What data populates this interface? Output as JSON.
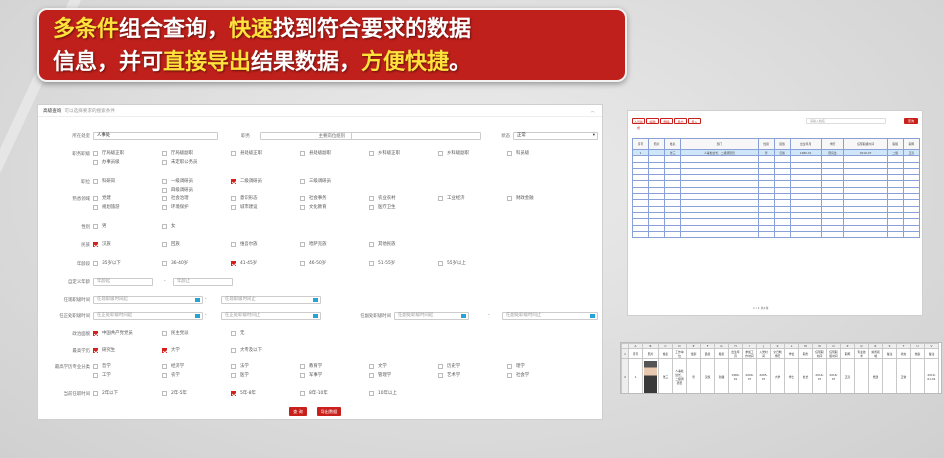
{
  "banner": {
    "line1_pre": "",
    "line1_hl1": "多条件",
    "line1_mid": "组合查询，",
    "line1_hl2": "快速",
    "line1_post": "找到符合要求的数据",
    "line2_pre": "信息，并可",
    "line2_hl1": "直接导出",
    "line2_mid": "结果数据，",
    "line2_hl2": "方便快捷",
    "line2_post": "。"
  },
  "form": {
    "title": "高级查询",
    "subtitle": "可以选择要求的搜索条件",
    "unit_label": "所在处室",
    "unit_value": "人事处",
    "post_label": "职务",
    "post_value": "",
    "mgr_label": "主要岗位组别",
    "mgr_value": "",
    "status_label": "状态",
    "status_value": "正常",
    "rank_label": "职务职级",
    "rank_opts": [
      "厅局级正职",
      "厅局级副职",
      "县处级正职",
      "县处级副职",
      "乡科级正职",
      "乡科级副职",
      "科员级",
      "办事员级",
      "未定职公务员"
    ],
    "level_label": "职位",
    "level_opts": [
      "一级调研员",
      "二级调研员",
      "三级调研员",
      "四级调研员"
    ],
    "level_first": "科研岗",
    "field_label": "熟悉领域",
    "field_opts": [
      "党建",
      "社会治理",
      "意识形态",
      "社会事务",
      "农业农村",
      "工业经济",
      "财政金融",
      "规划旅游",
      "环境保护",
      "城市建设",
      "文化教育",
      "医疗卫生"
    ],
    "sex_label": "性别",
    "sex_opts": [
      "男",
      "女"
    ],
    "nation_label": "民族",
    "nation_opts": [
      "汉族",
      "回族",
      "维吾尔族",
      "哈萨克族",
      "其他民族"
    ],
    "age_label": "年龄段",
    "age_opts": [
      "35岁以下",
      "36-40岁",
      "41-45岁",
      "46-50岁",
      "51-55岁",
      "55岁以上"
    ],
    "age_range_label": "自定义年龄",
    "age_from": "年龄起",
    "age_to": "年龄止",
    "cur_rank_label": "任现职级时间",
    "cur_rank_from": "任现职级时间起",
    "cur_rank_to": "任现职级时间止",
    "cur_post_label": "任正处职级时间",
    "cur_post_from": "任正处职级时间起",
    "cur_post_to": "任正处职级时间止",
    "first_label": "任副处职级时间",
    "first_from": "任副处职级时间起",
    "first_to": "任副处职级时间止",
    "party_label": "政治面貌",
    "party_opts": [
      "中国共产党党员",
      "民主党派",
      "无"
    ],
    "edu_label": "最高学历",
    "edu_opts": [
      "研究生",
      "大学",
      "大专及以下"
    ],
    "major_label": "最高学历专业分类",
    "major_opts": [
      "哲学",
      "经济学",
      "法学",
      "教育学",
      "文学",
      "历史学",
      "理学",
      "工学",
      "农学",
      "医学",
      "军事学",
      "管理学",
      "艺术学",
      "社会学"
    ],
    "years_label": "当前任职时间",
    "years_opts": [
      "2年以下",
      "2年-5年",
      "5年-8年",
      "8年-10年",
      "10年以上"
    ],
    "search_btn": "查 询",
    "export_btn": "导出数据"
  },
  "grid": {
    "buttons": [
      "人员新增",
      "编辑",
      "删除",
      "导出",
      "导入"
    ],
    "search_placeholder": "请输入姓名",
    "search_btn": "查询",
    "headers": [
      "序号",
      "照片",
      "姓名",
      "部门",
      "性别",
      "民族",
      "出生年月",
      "学历",
      "任现职级时间",
      "职级",
      "职称"
    ],
    "row1": [
      "1",
      "",
      "张三",
      "人事处处长，二级调研员",
      "男",
      "汉族",
      "1980-01",
      "研究生",
      "2016-07",
      "二级",
      "正高"
    ],
    "pager": "1 / 1 共1条"
  },
  "excel": {
    "cols": [
      "A",
      "B",
      "C",
      "D",
      "E",
      "F",
      "G",
      "H",
      "I",
      "J",
      "K",
      "L",
      "M",
      "N",
      "O",
      "P",
      "Q",
      "R",
      "S",
      "T",
      "U",
      "V"
    ],
    "head": [
      "序号",
      "照片",
      "姓名",
      "工作单位",
      "性别",
      "民族",
      "籍贯",
      "出生年月",
      "参加工作时间",
      "入党时间",
      "全日制学历",
      "学位",
      "职务",
      "任现职时间",
      "任现职级时间",
      "职称",
      "专业技术",
      "熟悉领域",
      "备注",
      "状态",
      "档案",
      "备注"
    ],
    "r1": [
      "1",
      "",
      "张三",
      "人事处处长，二级调研员",
      "男",
      "汉族",
      "新疆",
      "1980-01",
      "2000-07",
      "2005-07",
      "大学",
      "学士",
      "处长",
      "2016-07",
      "2018-07",
      "正高",
      "",
      "党建",
      "",
      "正常",
      "",
      "2019-01-01"
    ]
  },
  "colors": {
    "accent": "#c9201b",
    "highlight": "#ffe23a",
    "grid_border": "#8aa0d8",
    "row_active": "#cfe6f8"
  }
}
